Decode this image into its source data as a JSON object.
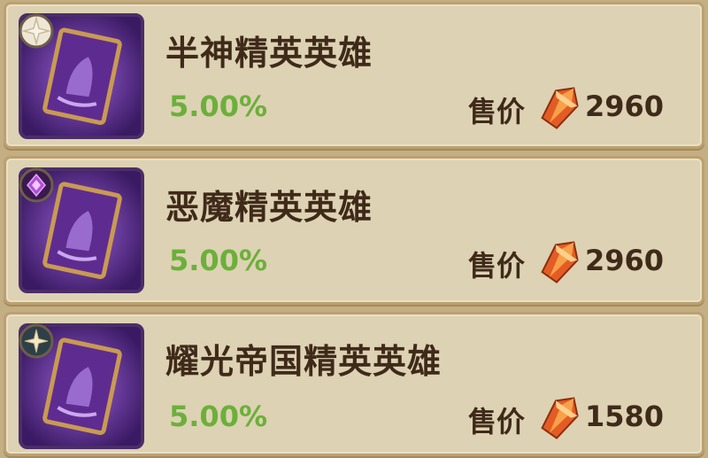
{
  "items": [
    {
      "name": "半神精英英雄",
      "rate": "5.00%",
      "price_label": "售价",
      "price": "2960",
      "faction_icon": "demigod-faction-icon",
      "card_icon": "hero-card-icon"
    },
    {
      "name": "恶魔精英英雄",
      "rate": "5.00%",
      "price_label": "售价",
      "price": "2960",
      "faction_icon": "demon-faction-icon",
      "card_icon": "hero-card-icon"
    },
    {
      "name": "耀光帝国精英英雄",
      "rate": "5.00%",
      "price_label": "售价",
      "price": "1580",
      "faction_icon": "radiant-empire-faction-icon",
      "card_icon": "hero-card-icon"
    }
  ],
  "colors": {
    "panel_bg": "#ddd2b3",
    "panel_border": "#bca070",
    "rate_green": "#6bb03a",
    "text_dark": "#3f2a1a",
    "card_purple": "#5a2d86",
    "card_gold": "#c99a52"
  }
}
